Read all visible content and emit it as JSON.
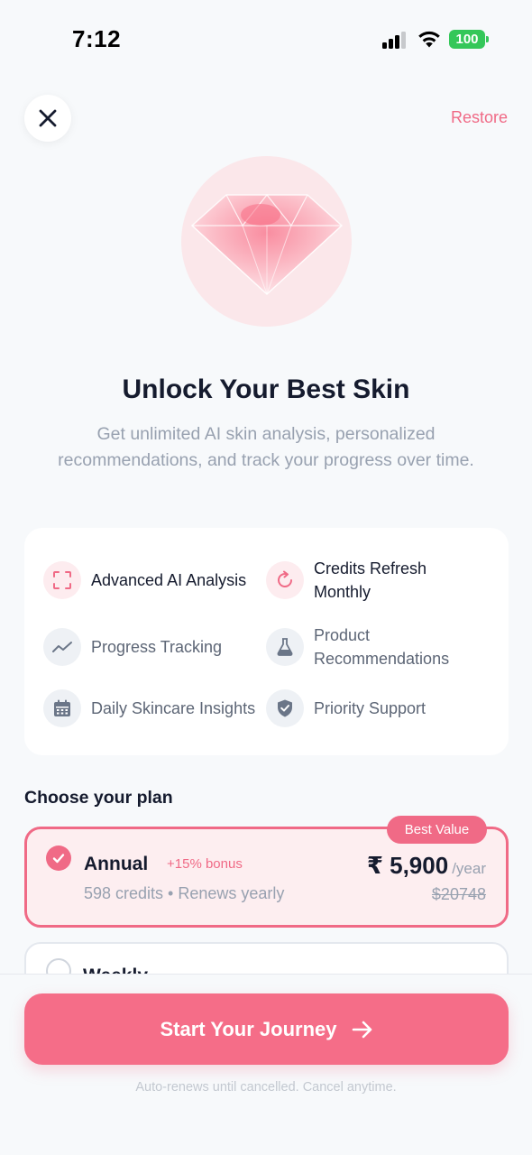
{
  "status_bar": {
    "time": "7:12",
    "battery": "100",
    "signal_icon": "cellular-signal-icon",
    "wifi_icon": "wifi-icon",
    "battery_color": "#34c759"
  },
  "header": {
    "close_icon": "close-icon",
    "restore_label": "Restore"
  },
  "hero": {
    "icon": "diamond-icon",
    "title": "Unlock Your Best Skin",
    "subtitle": "Get unlimited AI skin analysis, personalized recommendations, and track your progress over time."
  },
  "features": [
    {
      "label": "Advanced AI Analysis",
      "icon": "scan-frame-icon",
      "highlight": true
    },
    {
      "label": "Credits Refresh Monthly",
      "icon": "refresh-icon",
      "highlight": true
    },
    {
      "label": "Progress Tracking",
      "icon": "trend-line-icon",
      "highlight": false
    },
    {
      "label": "Product Recommendations",
      "icon": "flask-icon",
      "highlight": false
    },
    {
      "label": "Daily Skincare Insights",
      "icon": "calendar-icon",
      "highlight": false
    },
    {
      "label": "Priority Support",
      "icon": "shield-check-icon",
      "highlight": false
    }
  ],
  "plans": {
    "heading": "Choose your plan",
    "annual": {
      "badge": "Best Value",
      "name": "Annual",
      "bonus": "+15% bonus",
      "details": "598 credits • Renews yearly",
      "price": "₹ 5,900",
      "period": "/year",
      "old_price": "$20748",
      "selected": true
    },
    "weekly": {
      "name": "Weekly",
      "selected": false
    }
  },
  "cta": {
    "label": "Start Your Journey",
    "icon": "arrow-right-icon"
  },
  "footnote": "Auto-renews until cancelled. Cancel anytime.",
  "colors": {
    "accent": "#f06a86",
    "cta": "#f56d88",
    "background": "#f7f9fb",
    "text_dark": "#151b2e",
    "text_muted": "#98a1b0"
  }
}
